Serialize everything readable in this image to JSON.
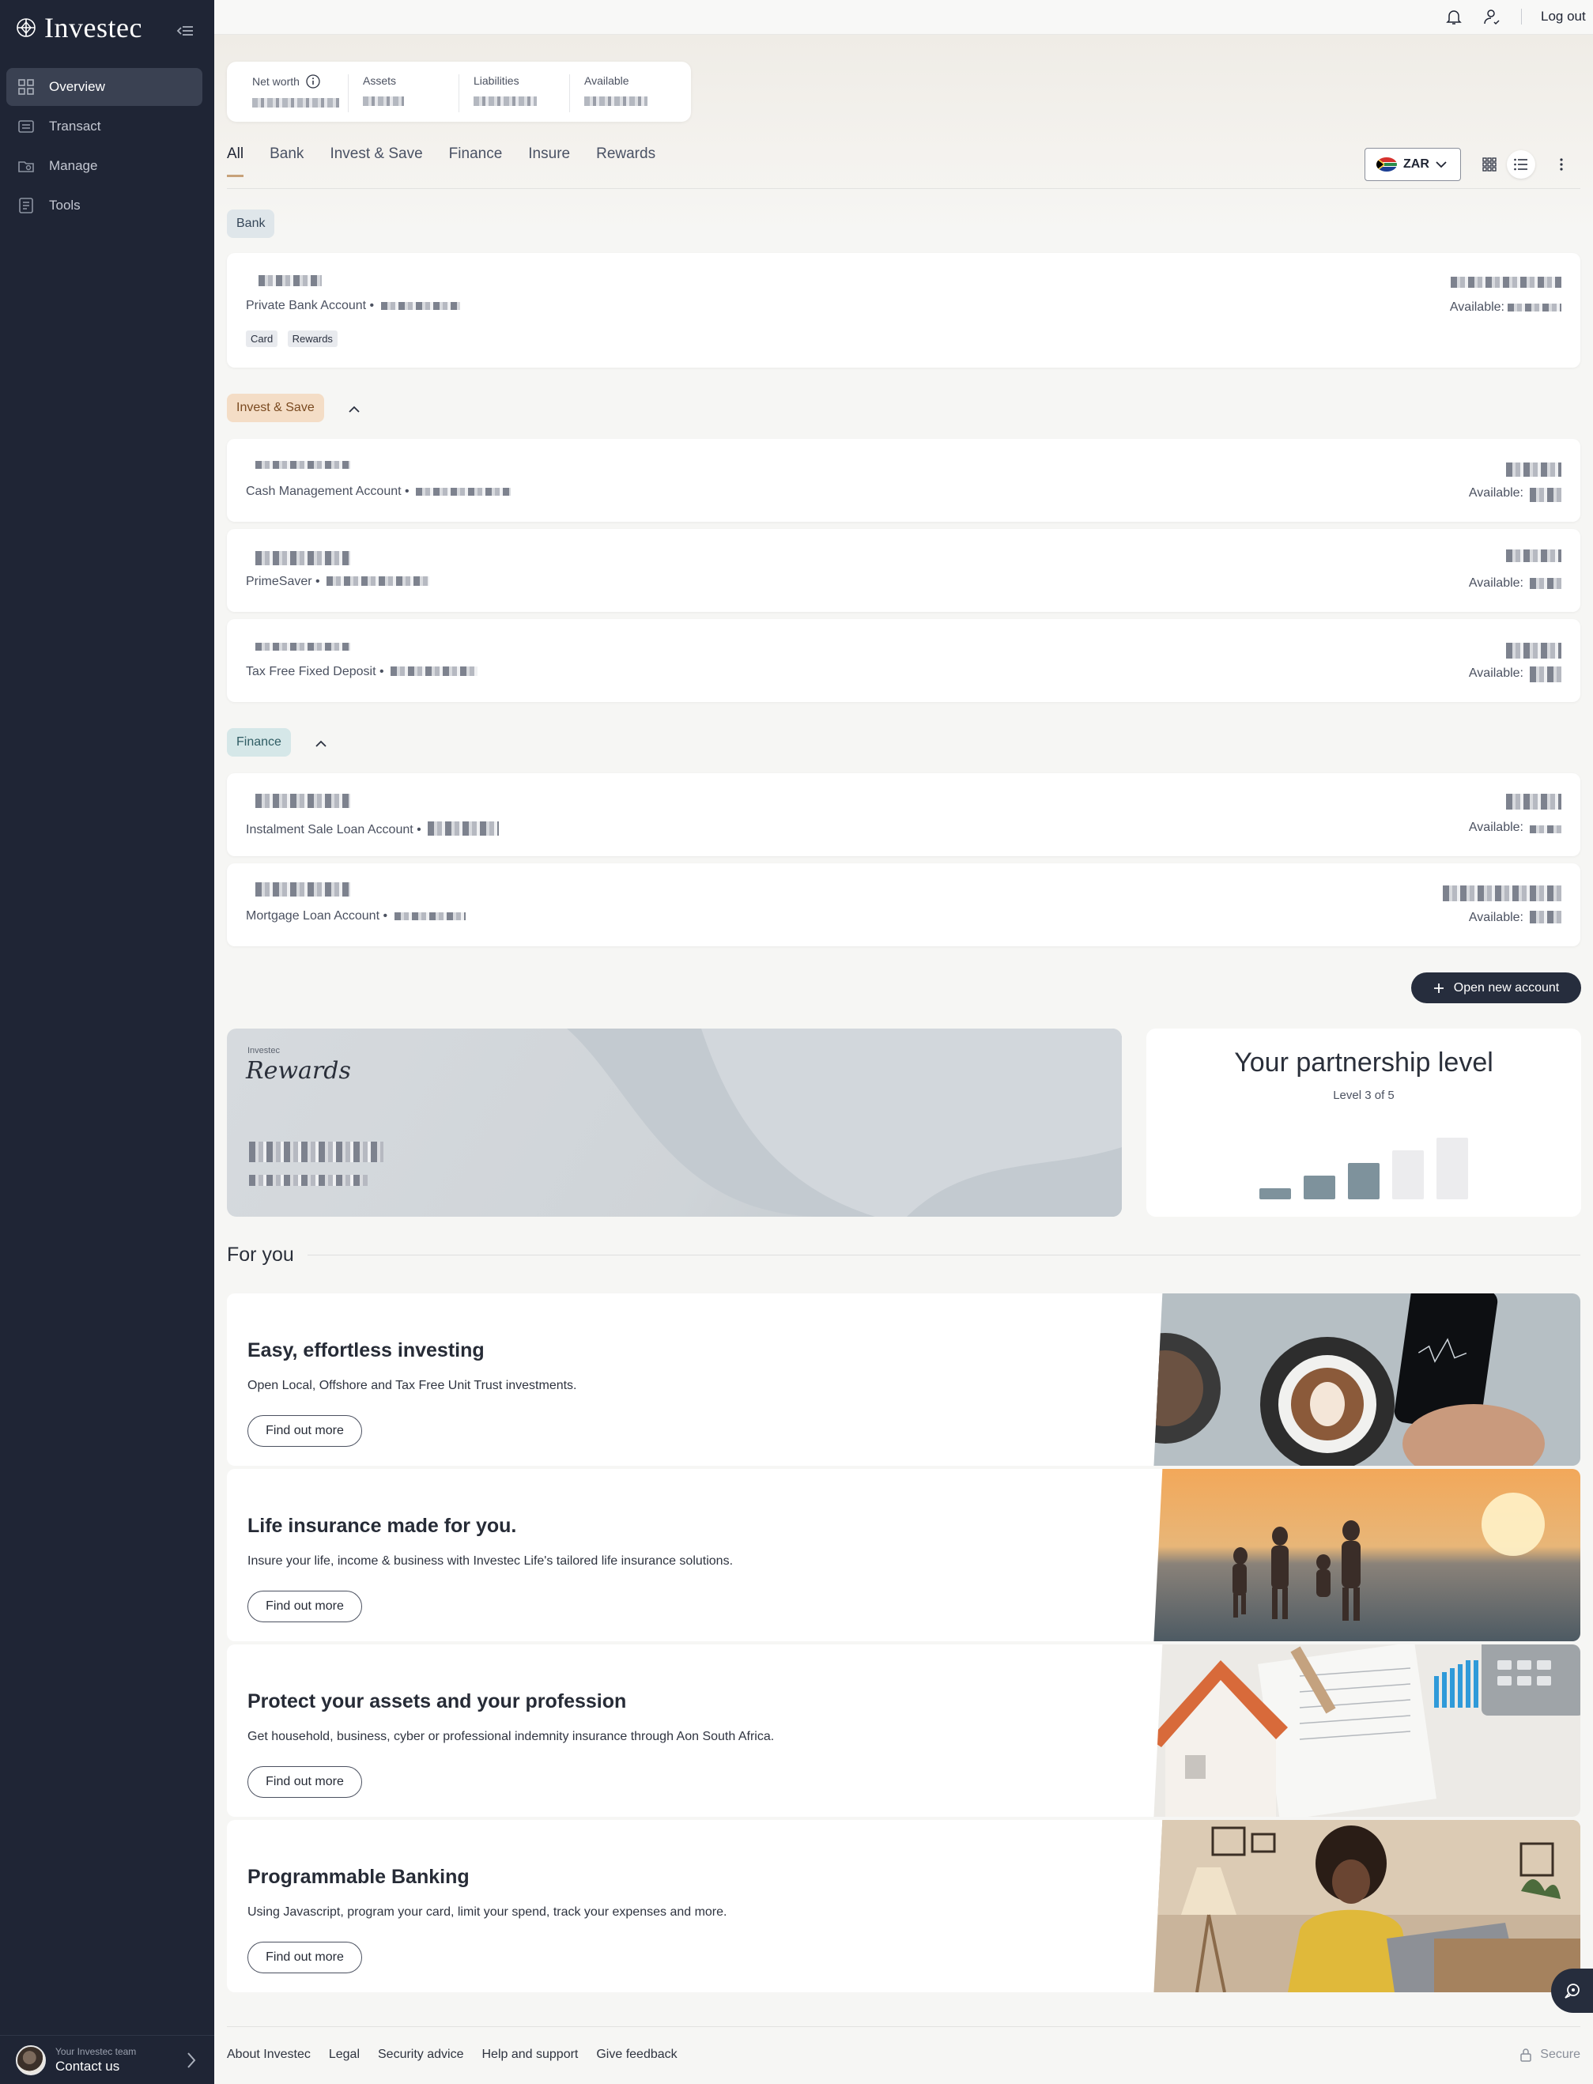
{
  "brand": {
    "name": "Investec"
  },
  "sidebar": {
    "items": [
      {
        "label": "Overview",
        "icon": "overview-icon",
        "active": true
      },
      {
        "label": "Transact",
        "icon": "transact-icon"
      },
      {
        "label": "Manage",
        "icon": "manage-icon"
      },
      {
        "label": "Tools",
        "icon": "tools-icon"
      }
    ],
    "contact": {
      "team_label": "Your Investec team",
      "label": "Contact us"
    }
  },
  "topbar": {
    "logout": "Log out"
  },
  "summary": {
    "net_worth": "Net worth",
    "assets": "Assets",
    "liabilities": "Liabilities",
    "available": "Available"
  },
  "tabs": [
    "All",
    "Bank",
    "Invest & Save",
    "Finance",
    "Insure",
    "Rewards"
  ],
  "currency": "ZAR",
  "sections": {
    "bank": "Bank",
    "invest": "Invest & Save",
    "finance": "Finance"
  },
  "accounts": {
    "private_bank": {
      "type": "Private Bank Account •",
      "available": "Available:",
      "tags": [
        "Card",
        "Rewards"
      ]
    },
    "cash_mgmt": {
      "type": "Cash Management Account •",
      "available": "Available:"
    },
    "primesaver": {
      "type": "PrimeSaver •",
      "available": "Available:"
    },
    "tax_free": {
      "type": "Tax Free Fixed Deposit •",
      "available": "Available:"
    },
    "instalment": {
      "type": "Instalment Sale Loan Account •",
      "available": "Available:"
    },
    "mortgage": {
      "type": "Mortgage Loan Account •",
      "available": "Available:"
    }
  },
  "open_account": "Open new account",
  "rewards": {
    "brand_small": "Investec",
    "title": "Rewards"
  },
  "partnership": {
    "title": "Your partnership level",
    "subtitle": "Level 3 of 5",
    "level": 3,
    "max_level": 5
  },
  "for_you": {
    "heading": "For you",
    "cards": [
      {
        "title": "Easy, effortless investing",
        "text": "Open Local, Offshore and Tax Free Unit Trust investments.",
        "button": "Find out more"
      },
      {
        "title": "Life insurance made for you.",
        "text": "Insure your life, income & business with Investec Life's tailored life insurance solutions.",
        "button": "Find out more"
      },
      {
        "title": "Protect your assets and your profession",
        "text": "Get household, business, cyber or professional indemnity insurance through Aon South Africa.",
        "button": "Find out more"
      },
      {
        "title": "Programmable Banking",
        "text": "Using Javascript, program your card, limit your spend, track your expenses and more.",
        "button": "Find out more"
      }
    ]
  },
  "footer": {
    "links": [
      "About Investec",
      "Legal",
      "Security advice",
      "Help and support",
      "Give feedback"
    ],
    "secure": "Secure"
  },
  "colors": {
    "sidebar": "#1f2535",
    "accent_tab": "#c7a27a",
    "primary_button": "#262d3d"
  }
}
